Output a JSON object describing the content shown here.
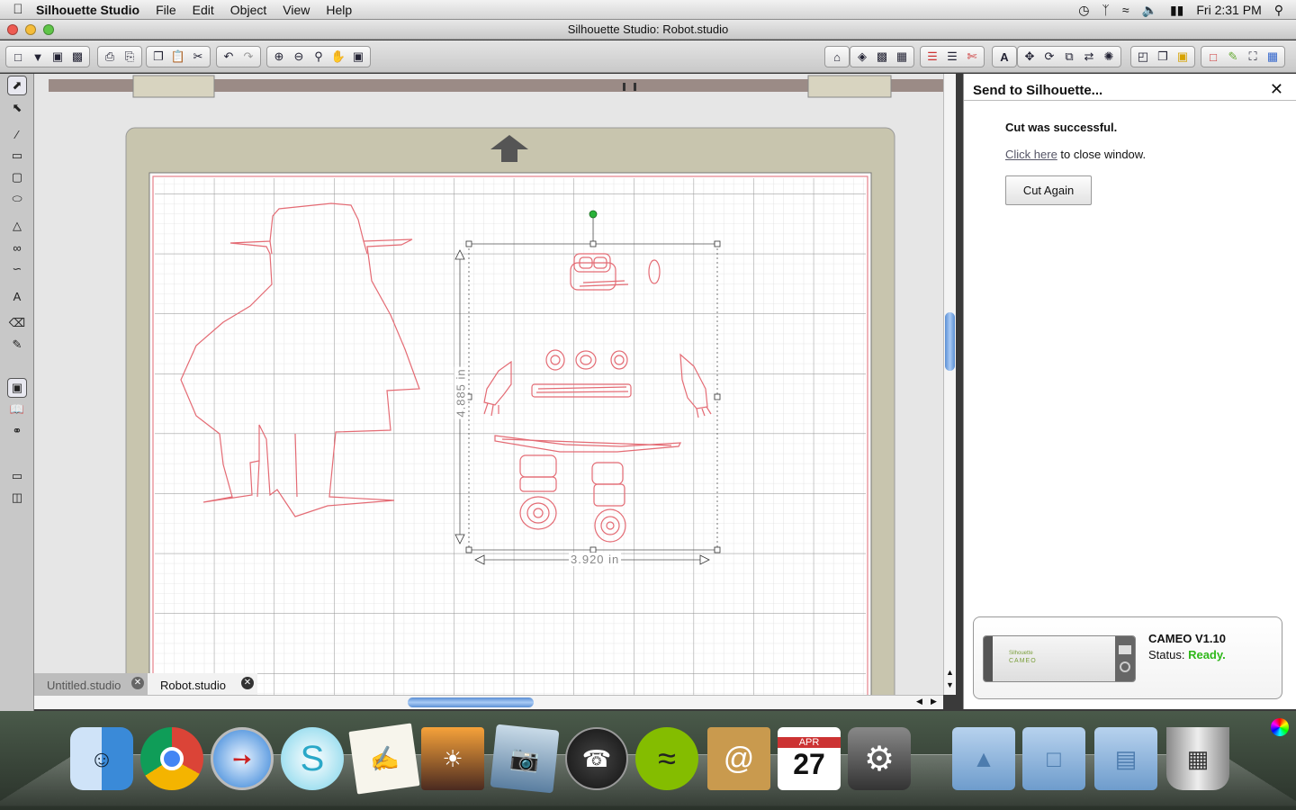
{
  "menubar": {
    "app_name": "Silhouette Studio",
    "items": [
      "File",
      "Edit",
      "Object",
      "View",
      "Help"
    ],
    "clock": "Fri 2:31 PM"
  },
  "window": {
    "title": "Silhouette Studio: Robot.studio"
  },
  "canvas": {
    "height_label": "4.885 in",
    "width_label": "3.920 in"
  },
  "tabs": [
    {
      "label": "Untitled.studio"
    },
    {
      "label": "Robot.studio"
    }
  ],
  "panel": {
    "title": "Send to Silhouette...",
    "message": "Cut was successful.",
    "link_text": "Click here",
    "link_suffix": " to close window.",
    "cut_again_label": "Cut Again",
    "device_name": "CAMEO V1.10",
    "status_label": "Status: ",
    "status_value": "Ready.",
    "status_color": "#2fb81a",
    "device_brand_small": "Silhouette",
    "device_brand": "CAMEO"
  },
  "dock": {
    "calendar_month": "APR",
    "calendar_day": "27",
    "items": [
      "finder-icon",
      "chrome-icon",
      "safari-icon",
      "silhouette-icon",
      "textedit-icon",
      "iphoto-icon",
      "preview-icon",
      "dashboard-icon",
      "spotify-icon",
      "addressbook-icon",
      "calendar-icon",
      "systemprefs-icon",
      "applications-folder-icon",
      "documents-folder-icon",
      "downloads-folder-icon",
      "trash-icon"
    ]
  }
}
